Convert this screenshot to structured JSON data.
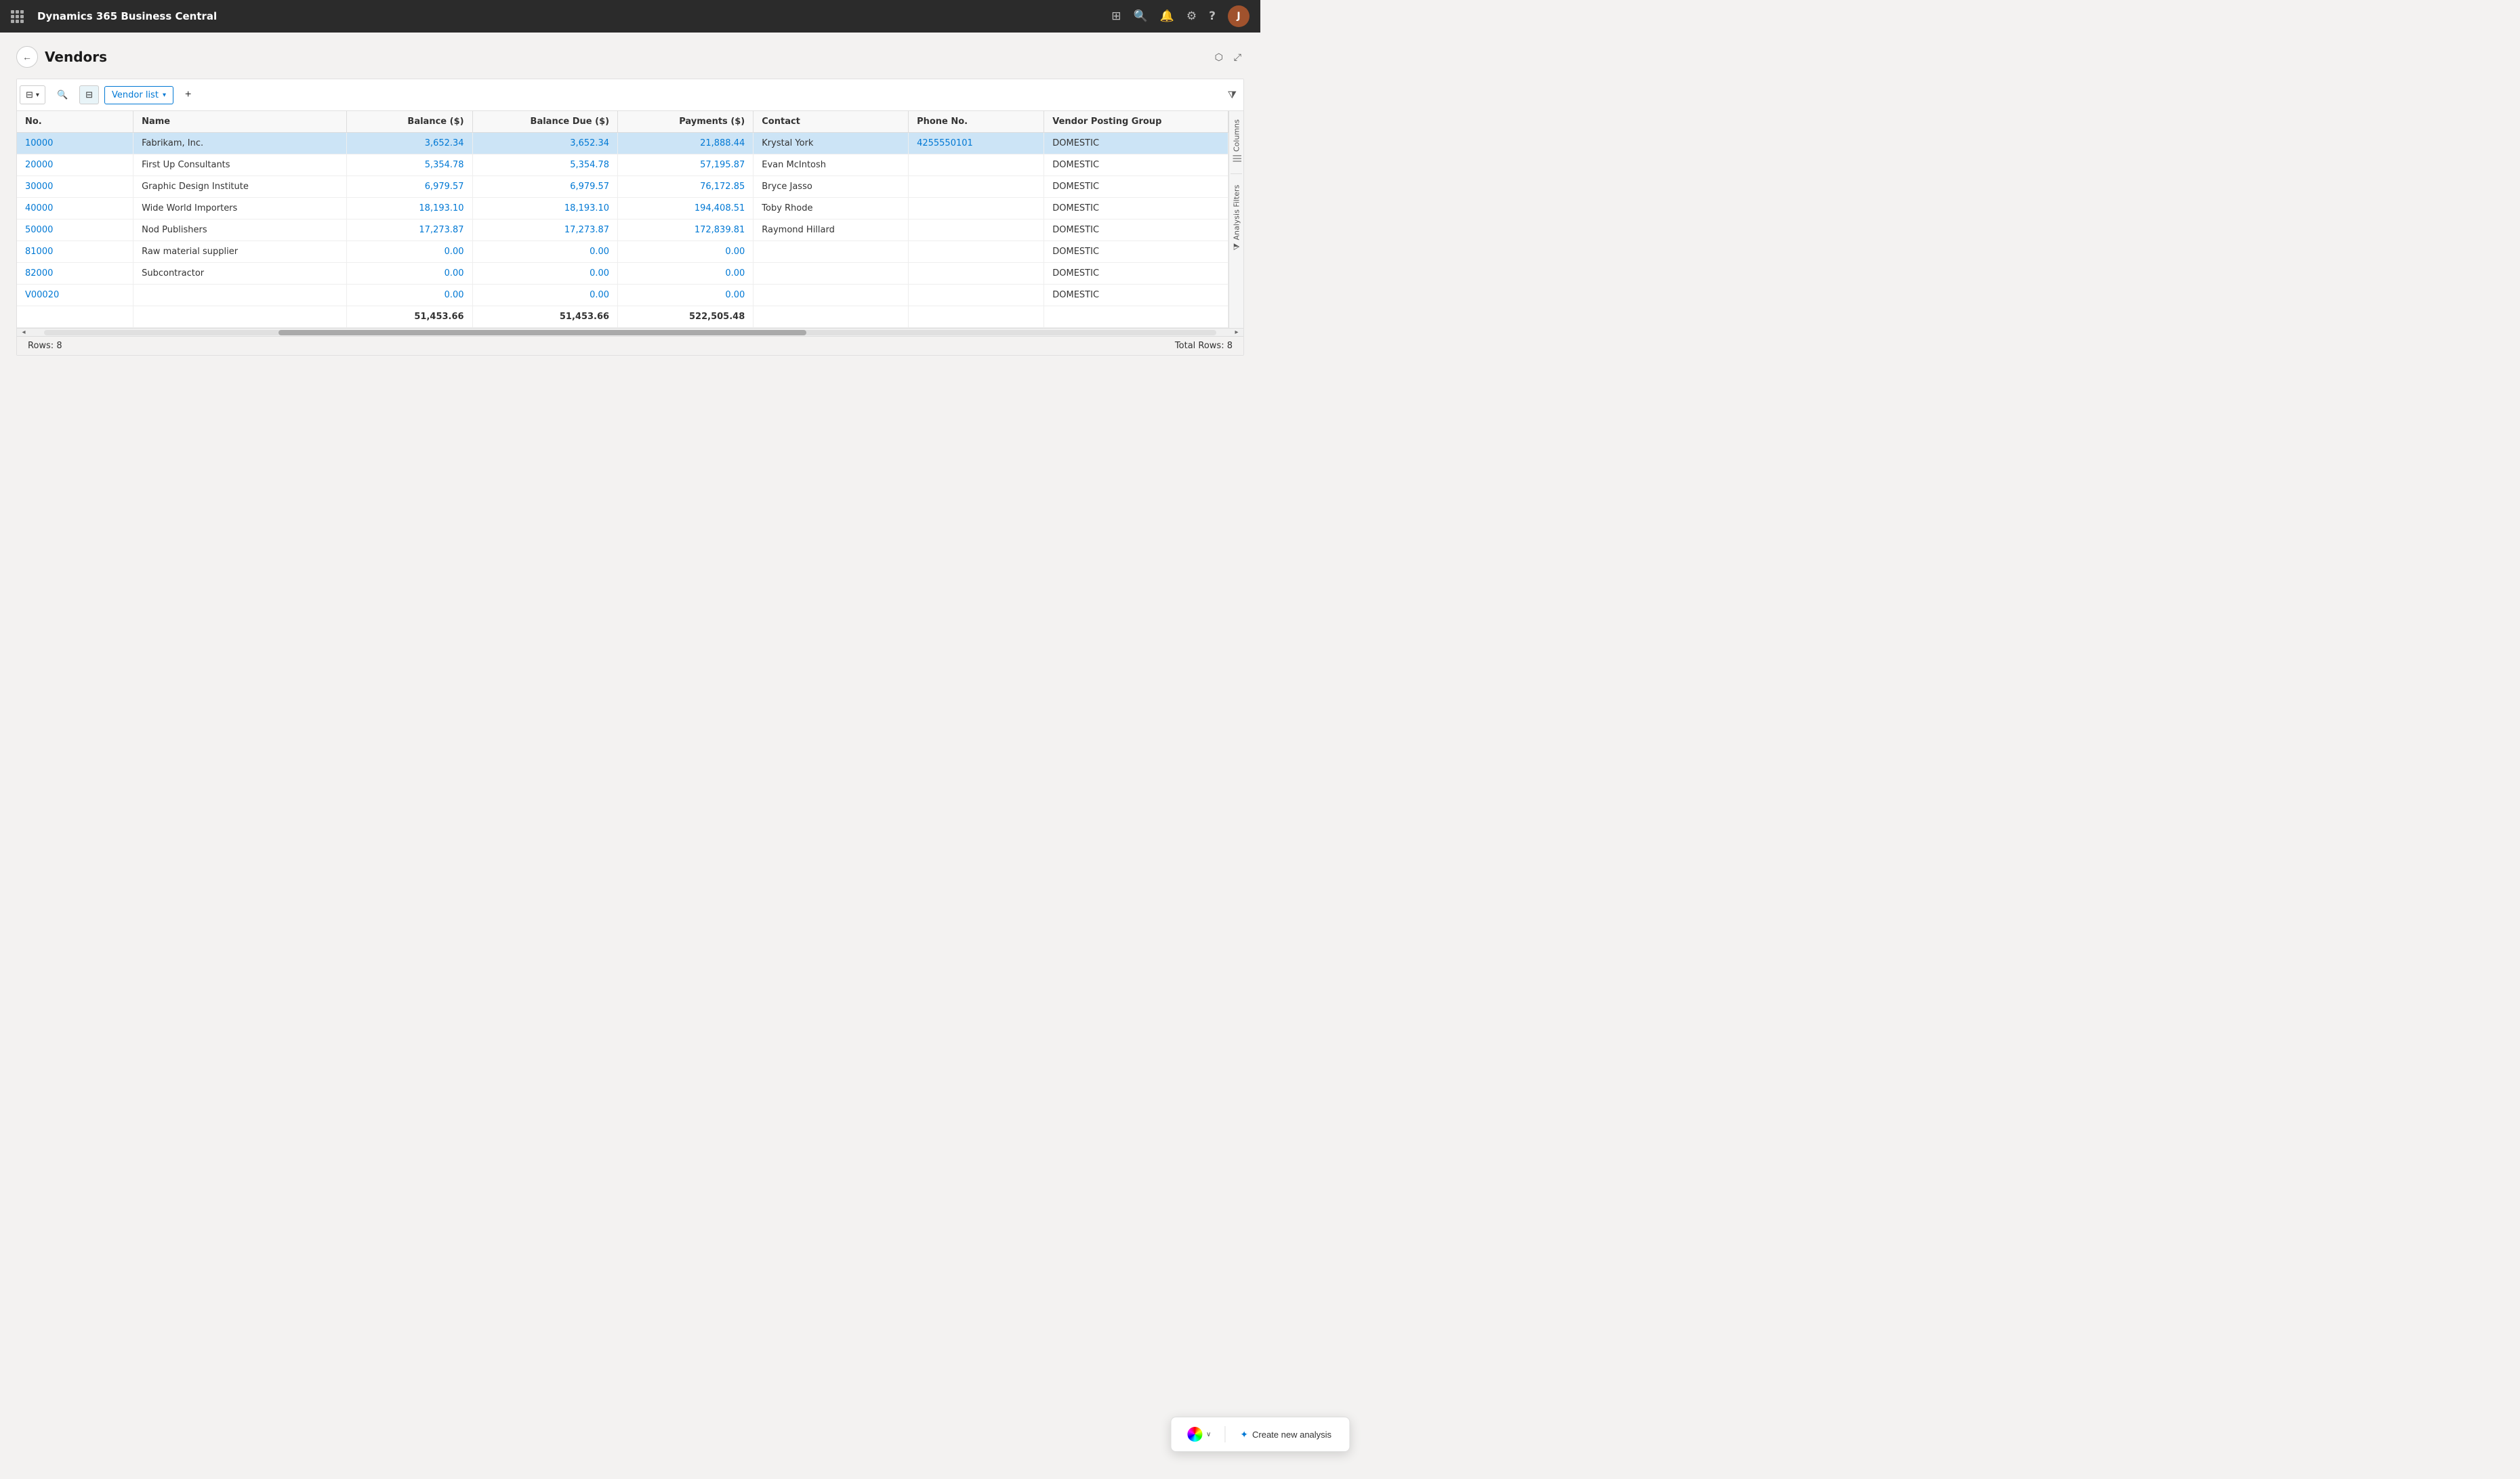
{
  "app": {
    "title": "Dynamics 365 Business Central"
  },
  "page": {
    "title": "Vendors",
    "back_label": "←"
  },
  "toolbar": {
    "view_dropdown_label": "Vendor list",
    "add_label": "+",
    "filter_label": "⊞"
  },
  "table": {
    "columns": [
      {
        "id": "no",
        "label": "No.",
        "numeric": false
      },
      {
        "id": "name",
        "label": "Name",
        "numeric": false
      },
      {
        "id": "balance",
        "label": "Balance ($)",
        "numeric": true
      },
      {
        "id": "balance_due",
        "label": "Balance Due ($)",
        "numeric": true
      },
      {
        "id": "payments",
        "label": "Payments ($)",
        "numeric": true
      },
      {
        "id": "contact",
        "label": "Contact",
        "numeric": false
      },
      {
        "id": "phone",
        "label": "Phone No.",
        "numeric": false
      },
      {
        "id": "vendor_posting_group",
        "label": "Vendor Posting Group",
        "numeric": false
      }
    ],
    "rows": [
      {
        "no": "10000",
        "name": "Fabrikam, Inc.",
        "balance": "3,652.34",
        "balance_due": "3,652.34",
        "payments": "21,888.44",
        "contact": "Krystal York",
        "phone": "4255550101",
        "vendor_posting_group": "DOMESTIC",
        "selected": true
      },
      {
        "no": "20000",
        "name": "First Up Consultants",
        "balance": "5,354.78",
        "balance_due": "5,354.78",
        "payments": "57,195.87",
        "contact": "Evan McIntosh",
        "phone": "",
        "vendor_posting_group": "DOMESTIC",
        "selected": false
      },
      {
        "no": "30000",
        "name": "Graphic Design Institute",
        "balance": "6,979.57",
        "balance_due": "6,979.57",
        "payments": "76,172.85",
        "contact": "Bryce Jasso",
        "phone": "",
        "vendor_posting_group": "DOMESTIC",
        "selected": false
      },
      {
        "no": "40000",
        "name": "Wide World Importers",
        "balance": "18,193.10",
        "balance_due": "18,193.10",
        "payments": "194,408.51",
        "contact": "Toby Rhode",
        "phone": "",
        "vendor_posting_group": "DOMESTIC",
        "selected": false
      },
      {
        "no": "50000",
        "name": "Nod Publishers",
        "balance": "17,273.87",
        "balance_due": "17,273.87",
        "payments": "172,839.81",
        "contact": "Raymond Hillard",
        "phone": "",
        "vendor_posting_group": "DOMESTIC",
        "selected": false
      },
      {
        "no": "81000",
        "name": "Raw material supplier",
        "balance": "0.00",
        "balance_due": "0.00",
        "payments": "0.00",
        "contact": "",
        "phone": "",
        "vendor_posting_group": "DOMESTIC",
        "selected": false
      },
      {
        "no": "82000",
        "name": "Subcontractor",
        "balance": "0.00",
        "balance_due": "0.00",
        "payments": "0.00",
        "contact": "",
        "phone": "",
        "vendor_posting_group": "DOMESTIC",
        "selected": false
      },
      {
        "no": "V00020",
        "name": "",
        "balance": "0.00",
        "balance_due": "0.00",
        "payments": "0.00",
        "contact": "",
        "phone": "",
        "vendor_posting_group": "DOMESTIC",
        "selected": false
      }
    ],
    "totals": {
      "balance": "51,453.66",
      "balance_due": "51,453.66",
      "payments": "522,505.48"
    }
  },
  "side_panel": {
    "columns_label": "Columns",
    "analysis_filters_label": "Analysis Filters"
  },
  "bottom_bar": {
    "rows_label": "Rows: 8",
    "total_rows_label": "Total Rows: 8"
  },
  "floating_bar": {
    "copilot_chevron": "∨",
    "create_analysis_label": "Create new analysis",
    "sparkle": "✦"
  },
  "icons": {
    "grid": "⊞",
    "search": "🔍",
    "table_view": "⊟",
    "settings": "⚙",
    "bell": "🔔",
    "help": "?",
    "back_arrow": "←",
    "external_link": "⬡",
    "compress": "⤢",
    "filter": "⧩",
    "plus": "+",
    "columns_icon": "|||",
    "analysis_icon": "⊡"
  },
  "colors": {
    "accent_blue": "#0078d4",
    "nav_bg": "#2c2c2c",
    "link_blue": "#0078d4",
    "selected_bg": "#cce4f6",
    "header_bg": "#f8f8f8"
  }
}
